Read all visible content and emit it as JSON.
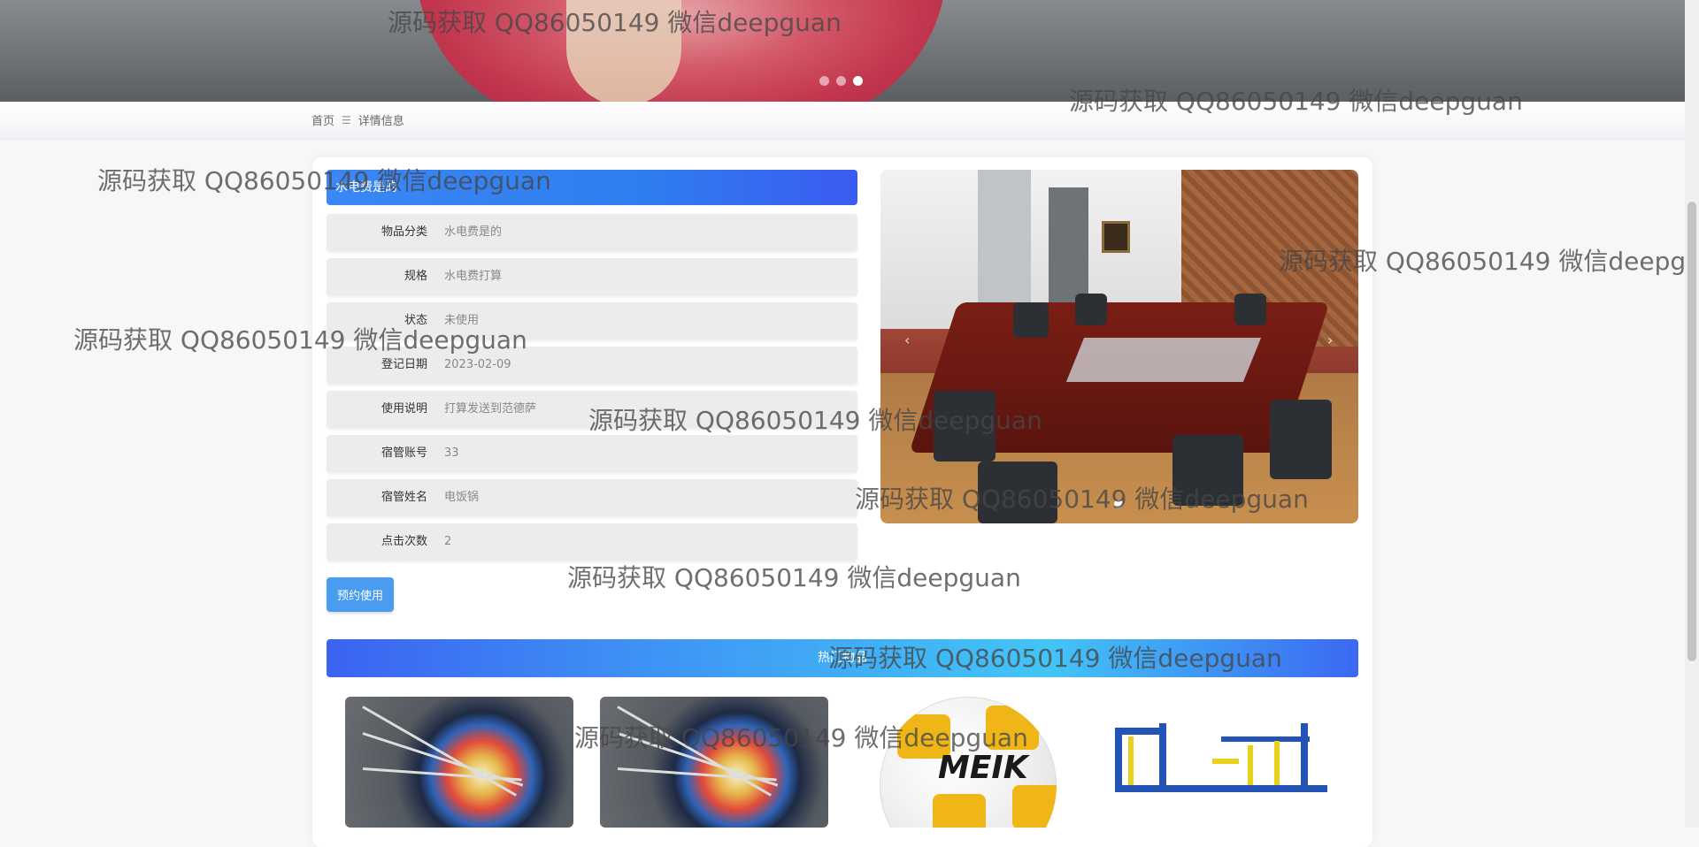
{
  "banner": {
    "slides": 3,
    "active_index": 2
  },
  "breadcrumb": {
    "home": "首页",
    "separator": "☰",
    "current": "详情信息"
  },
  "item": {
    "title": "水电费是的",
    "fields": [
      {
        "label": "物品分类",
        "value": "水电费是的"
      },
      {
        "label": "规格",
        "value": "水电费打算"
      },
      {
        "label": "状态",
        "value": "未使用"
      },
      {
        "label": "登记日期",
        "value": "2023-02-09"
      },
      {
        "label": "使用说明",
        "value": "打算发送到范德萨"
      },
      {
        "label": "宿管账号",
        "value": "33"
      },
      {
        "label": "宿管姓名",
        "value": "电饭锅"
      },
      {
        "label": "点击次数",
        "value": "2"
      }
    ],
    "reserve_label": "预约使用"
  },
  "gallery": {
    "prev_icon": "‹",
    "next_icon": "›"
  },
  "hot": {
    "title": "热门物品",
    "ball_brand": "MEIK"
  },
  "watermark": "源码获取 QQ86050149 微信deepguan"
}
